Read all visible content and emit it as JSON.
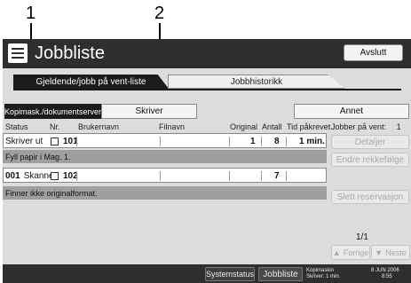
{
  "callouts": [
    "1",
    "2"
  ],
  "app": {
    "title": "Jobbliste",
    "exit_label": "Avslutt"
  },
  "tabs": [
    {
      "label": "Gjeldende/jobb på vent-liste",
      "active": true
    },
    {
      "label": "Jobbhistorikk",
      "active": false
    }
  ],
  "subtabs": [
    {
      "label": "Kopimask./dokumentserver",
      "active": true
    },
    {
      "label": "Skriver",
      "active": false
    },
    {
      "label": "Annet",
      "active": false
    }
  ],
  "columns": {
    "status": "Status",
    "nr": "Nr.",
    "user": "Brukernavn",
    "file": "Filnavn",
    "original": "Original",
    "count": "Antall",
    "time": "Tid påkrevet"
  },
  "jobs_waiting_label": "Jobber på vent:",
  "jobs_waiting_count": "1",
  "jobs": [
    {
      "status": "Skriver ut",
      "nr": "101",
      "user": "",
      "file": "",
      "original": "1",
      "count": "8",
      "time": "1 min.",
      "message": "Fyll papir i Mag. 1."
    },
    {
      "status_prefix": "001",
      "status": "Skanner",
      "nr": "102",
      "user": "",
      "file": "",
      "original": "",
      "count": "7",
      "time": "",
      "message": "Finner ikke originalformat."
    }
  ],
  "side_buttons": {
    "details": "Detaljer",
    "change_order": "Endre rekkefølge",
    "delete_reservation": "Slett reservasjon"
  },
  "pager": {
    "page": "1/1",
    "prev": "Forrige",
    "next": "Neste"
  },
  "bottom_bar": {
    "system_status": "Systemstatus",
    "job_list": "Jobbliste",
    "status_line1": "Kopimaskin",
    "status_line2": "Skriver: 1 min.",
    "date": "8 JUN  2006",
    "time": "8:55"
  },
  "colors": {
    "titlebar": "#2e2e2e",
    "screen_bg": "#dcdcdc",
    "message_bar": "#9f9f9f",
    "active_tab": "#1b1b1b"
  }
}
